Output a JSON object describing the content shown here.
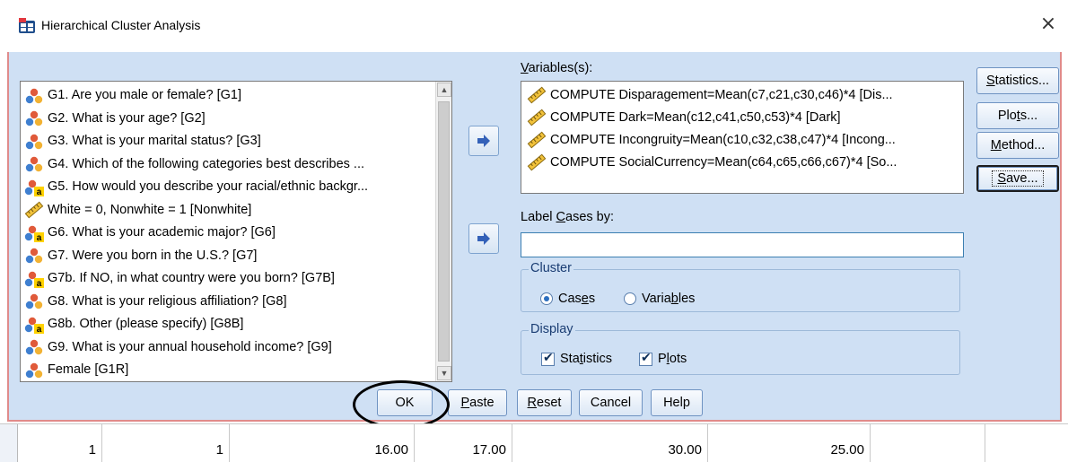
{
  "window": {
    "title": "Hierarchical Cluster Analysis",
    "close_glyph": "×"
  },
  "source_list": {
    "items": [
      {
        "label": "G1. Are you male or female? [G1]",
        "icon": "nominal-icon"
      },
      {
        "label": "G2. What is your age? [G2]",
        "icon": "nominal-icon"
      },
      {
        "label": "G3. What is your marital status? [G3]",
        "icon": "nominal-icon"
      },
      {
        "label": "G4. Which of the following categories best describes ...",
        "icon": "nominal-icon"
      },
      {
        "label": "G5. How would you describe your racial/ethnic backgr...",
        "icon": "nominal-string-icon"
      },
      {
        "label": "White = 0, Nonwhite = 1 [Nonwhite]",
        "icon": "scale-icon"
      },
      {
        "label": "G6. What is your academic major? [G6]",
        "icon": "nominal-string-icon"
      },
      {
        "label": "G7. Were you born in the U.S.? [G7]",
        "icon": "nominal-icon"
      },
      {
        "label": "G7b. If NO, in what country were you born? [G7B]",
        "icon": "nominal-string-icon"
      },
      {
        "label": "G8. What is your religious affiliation? [G8]",
        "icon": "nominal-icon"
      },
      {
        "label": "G8b. Other (please specify) [G8B]",
        "icon": "nominal-string-icon"
      },
      {
        "label": "G9. What is your annual household income? [G9]",
        "icon": "nominal-icon"
      },
      {
        "label": "Female  [G1R]",
        "icon": "nominal-icon"
      }
    ]
  },
  "variables": {
    "label_pre": "",
    "label_key": "V",
    "label_post": "ariables(s):",
    "items": [
      "COMPUTE Disparagement=Mean(c7,c21,c30,c46)*4 [Dis...",
      "COMPUTE Dark=Mean(c12,c41,c50,c53)*4 [Dark]",
      "COMPUTE Incongruity=Mean(c10,c32,c38,c47)*4 [Incong...",
      "COMPUTE SocialCurrency=Mean(c64,c65,c66,c67)*4 [So..."
    ]
  },
  "label_cases": {
    "label_pre": "Label ",
    "label_key": "C",
    "label_post": "ases by:",
    "value": ""
  },
  "cluster": {
    "title": "Cluster",
    "cases": {
      "pre": "Cas",
      "key": "e",
      "post": "s",
      "checked": true
    },
    "variables": {
      "pre": "Varia",
      "key": "b",
      "post": "les",
      "checked": false
    }
  },
  "display": {
    "title": "Display",
    "statistics": {
      "pre": "Sta",
      "key": "t",
      "post": "istics",
      "checked": true
    },
    "plots": {
      "pre": "P",
      "key": "l",
      "post": "ots",
      "checked": true
    }
  },
  "side_buttons": {
    "statistics": {
      "pre": "",
      "key": "S",
      "post": "tatistics..."
    },
    "plots": {
      "pre": "Plo",
      "key": "t",
      "post": "s..."
    },
    "method": {
      "pre": "",
      "key": "M",
      "post": "ethod..."
    },
    "save": {
      "pre": "",
      "key": "S",
      "post": "ave..."
    }
  },
  "bottom_buttons": {
    "ok": "OK",
    "paste": {
      "pre": "",
      "key": "P",
      "post": "aste"
    },
    "reset": {
      "pre": "",
      "key": "R",
      "post": "eset"
    },
    "cancel": "Cancel",
    "help": "Help"
  },
  "grid_row": [
    "1",
    "1",
    "16.00",
    "17.00",
    "30.00",
    "25.00"
  ],
  "colors": {
    "dialog_bg": "#cfe0f4",
    "accent": "#2d6fbf",
    "annotation": "#000000"
  }
}
